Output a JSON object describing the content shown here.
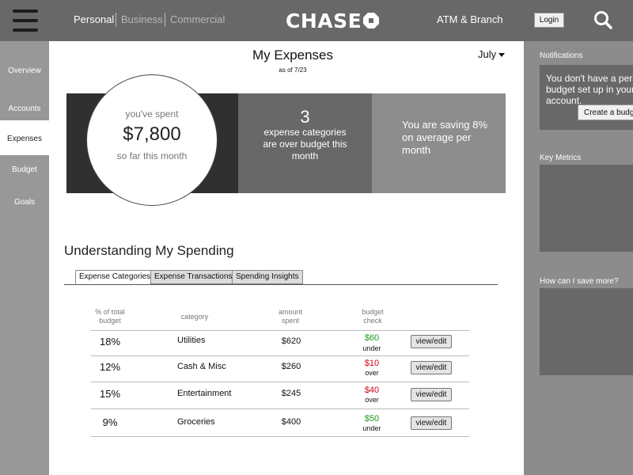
{
  "header": {
    "nav": [
      "Personal",
      "Business",
      "Commercial"
    ],
    "brand": "CHASE",
    "atm_branch": "ATM & Branch",
    "login": "Login"
  },
  "sidebar": {
    "items": [
      {
        "label": "Overview"
      },
      {
        "label": "Accounts"
      },
      {
        "label": "Expenses",
        "active": true
      },
      {
        "label": "Budget"
      },
      {
        "label": "Goals"
      }
    ]
  },
  "main": {
    "title": "My Expenses",
    "as_of": "as of 7/23",
    "month": "July",
    "summary": {
      "spent_label": "you've spent",
      "spent_amount": "$7,800",
      "spent_sub": "so far this month",
      "over_count": "3",
      "over_text": "expense categories are over budget this month",
      "saving_text": "You are saving 8% on average per month"
    },
    "section_title": "Understanding My Spending",
    "tabs": [
      "Expense Categories",
      "Expense Transactions",
      "Spending Insights"
    ],
    "table": {
      "headers": [
        "% of total budget",
        "category",
        "amount spent",
        "budget check"
      ],
      "rows": [
        {
          "pct": "18%",
          "category": "Utilities",
          "amount": "$620",
          "check_amount": "$60",
          "check_word": "under",
          "status": "under",
          "action": "view/edit"
        },
        {
          "pct": "12%",
          "category": "Cash & Misc",
          "amount": "$260",
          "check_amount": "$10",
          "check_word": "over",
          "status": "over",
          "action": "view/edit"
        },
        {
          "pct": "15%",
          "category": "Entertainment",
          "amount": "$245",
          "check_amount": "$40",
          "check_word": "over",
          "status": "over",
          "action": "view/edit"
        },
        {
          "pct": "9%",
          "category": "Groceries",
          "amount": "$400",
          "check_amount": "$50",
          "check_word": "under",
          "status": "under",
          "action": "view/edit"
        }
      ]
    }
  },
  "right_panel": {
    "notifications_label": "Notifications",
    "notification_text": "You don't have a personal budget set up in your account.",
    "notification_button": "Create a budget",
    "key_metrics_label": "Key Metrics",
    "save_more_label": "How can I save more?"
  },
  "colors": {
    "over": "#d0021b",
    "under": "#1a9a1a"
  }
}
